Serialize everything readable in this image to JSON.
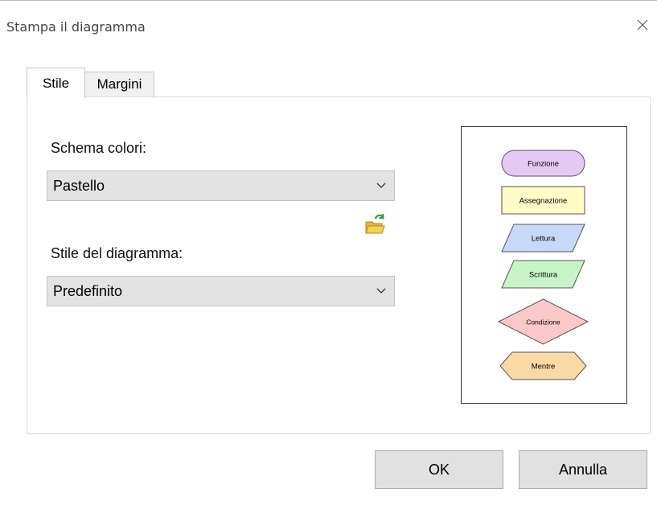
{
  "window": {
    "title": "Stampa il diagramma"
  },
  "tabs": [
    {
      "label": "Stile",
      "active": true
    },
    {
      "label": "Margini",
      "active": false
    }
  ],
  "style_tab": {
    "color_scheme_label": "Schema colori:",
    "color_scheme_value": "Pastello",
    "diagram_style_label": "Stile del diagramma:",
    "diagram_style_value": "Predefinito"
  },
  "preview": {
    "shapes": [
      {
        "label": "Funzione",
        "kind": "rounded",
        "fill": "#e4c9f5"
      },
      {
        "label": "Assegnazione",
        "kind": "rectangle",
        "fill": "#fffcc8"
      },
      {
        "label": "Lettura",
        "kind": "parallelogram",
        "fill": "#c8d8f8"
      },
      {
        "label": "Scrittura",
        "kind": "parallelogram",
        "fill": "#c8f5c8"
      },
      {
        "label": "Condizione",
        "kind": "diamond",
        "fill": "#fac8c8"
      },
      {
        "label": "Mentre",
        "kind": "hexagon",
        "fill": "#fbd9a4"
      }
    ]
  },
  "buttons": {
    "ok": "OK",
    "cancel": "Annulla"
  },
  "icons": {
    "close": "close-icon",
    "dropdown": "chevron-down-icon",
    "folder": "open-folder-icon"
  }
}
